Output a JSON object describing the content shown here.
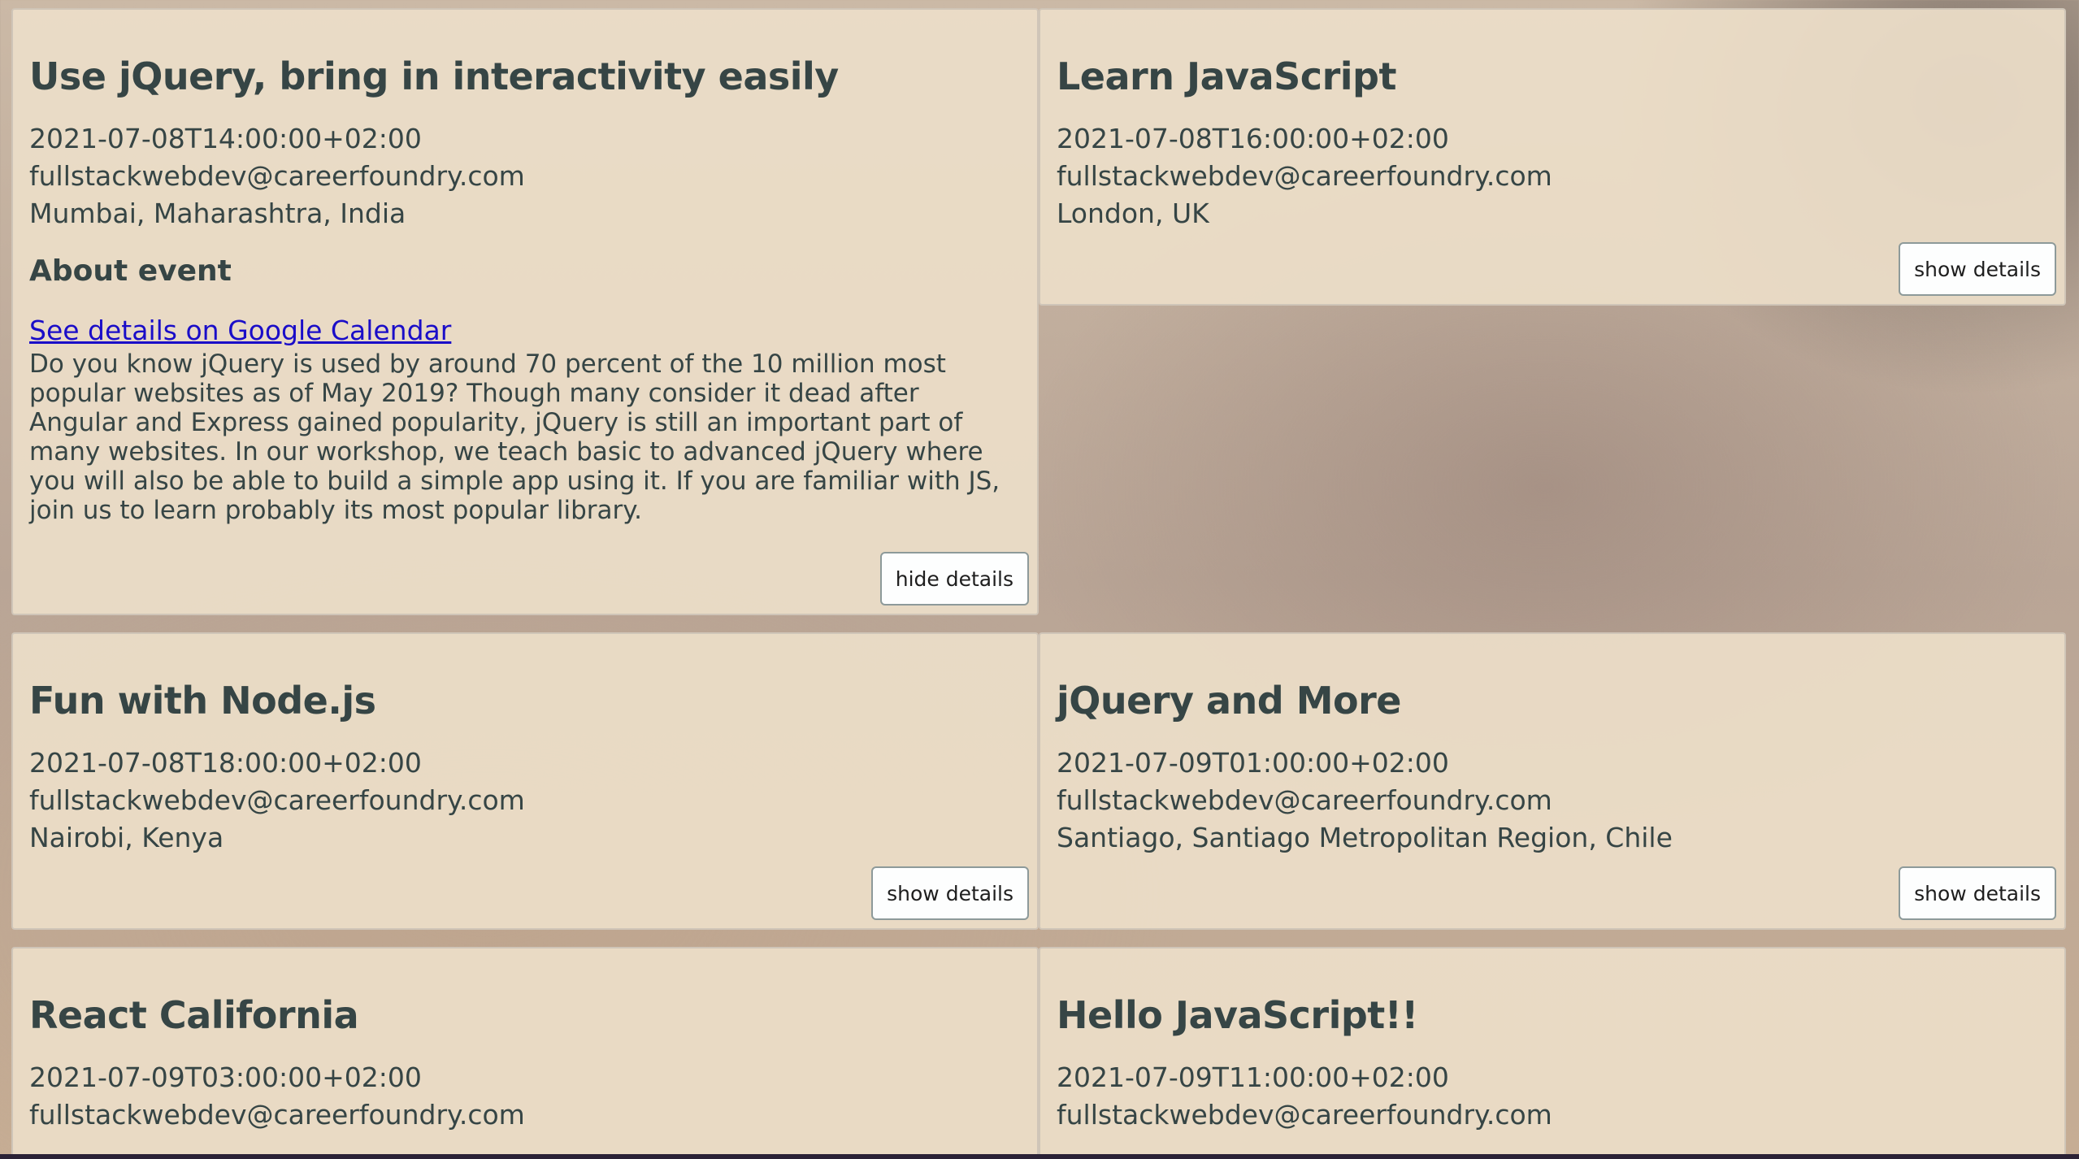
{
  "events": [
    {
      "title": "Use jQuery, bring in interactivity easily",
      "datetime": "2021-07-08T14:00:00+02:00",
      "organizer": "fullstackwebdev@careerfoundry.com",
      "location": "Mumbai, Maharashtra, India",
      "about_heading": "About event",
      "calendar_link": "See details on Google Calendar",
      "description": "Do you know jQuery is used by around 70 percent of the 10 million most popular websites as of May 2019? Though many consider it dead after Angular and Express gained popularity, jQuery is still an important part of many websites. In our workshop, we teach basic to advanced jQuery where you will also be able to build a simple app using it. If you are familiar with JS, join us to learn probably its most popular library.",
      "button_label": "hide details"
    },
    {
      "title": "Learn JavaScript",
      "datetime": "2021-07-08T16:00:00+02:00",
      "organizer": "fullstackwebdev@careerfoundry.com",
      "location": "London, UK",
      "button_label": "show details"
    },
    {
      "title": "Fun with Node.js",
      "datetime": "2021-07-08T18:00:00+02:00",
      "organizer": "fullstackwebdev@careerfoundry.com",
      "location": "Nairobi, Kenya",
      "button_label": "show details"
    },
    {
      "title": "jQuery and More",
      "datetime": "2021-07-09T01:00:00+02:00",
      "organizer": "fullstackwebdev@careerfoundry.com",
      "location": "Santiago, Santiago Metropolitan Region, Chile",
      "button_label": "show details"
    },
    {
      "title": "React California",
      "datetime": "2021-07-09T03:00:00+02:00",
      "organizer": "fullstackwebdev@careerfoundry.com"
    },
    {
      "title": "Hello JavaScript!!",
      "datetime": "2021-07-09T11:00:00+02:00",
      "organizer": "fullstackwebdev@careerfoundry.com"
    }
  ]
}
